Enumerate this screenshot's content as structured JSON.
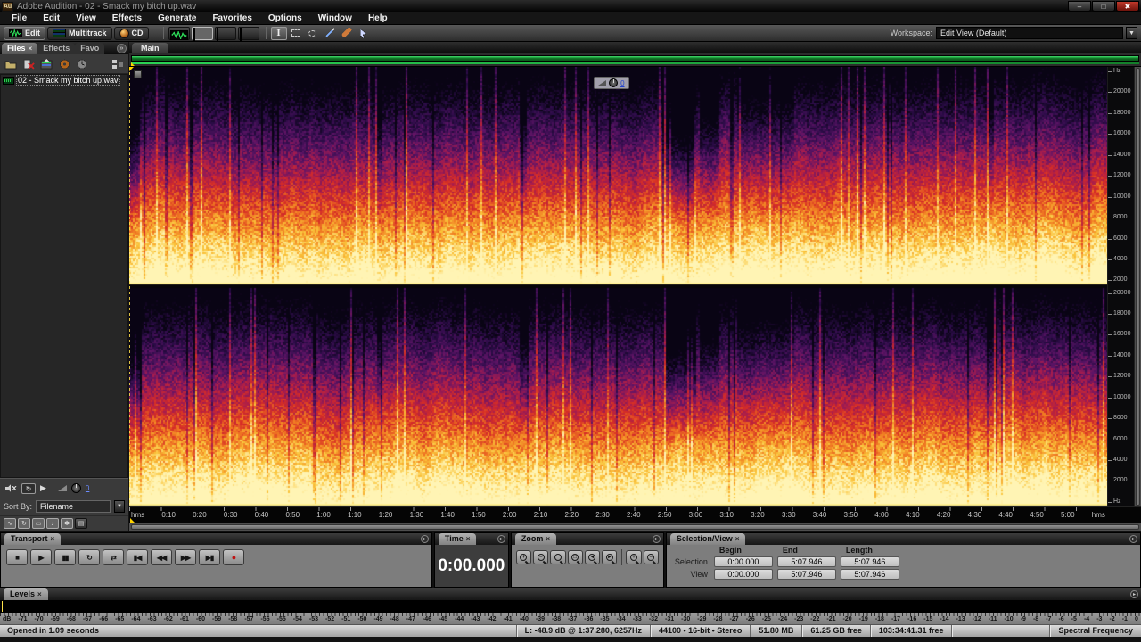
{
  "window": {
    "app_icon": "Au",
    "title": "Adobe Audition - 02 - Smack my bitch up.wav",
    "minimize": "–",
    "restore": "□",
    "close": "✖"
  },
  "menu": {
    "items": [
      "File",
      "Edit",
      "View",
      "Effects",
      "Generate",
      "Favorites",
      "Options",
      "Window",
      "Help"
    ]
  },
  "toolbar": {
    "edit_label": "Edit",
    "multitrack_label": "Multitrack",
    "cd_label": "CD",
    "workspace_label": "Workspace:",
    "workspace_value": "Edit View (Default)",
    "dropdown_arrow": "▼"
  },
  "files_panel": {
    "tab_files": "Files",
    "tab_effects": "Effects",
    "tab_favorites": "Favo",
    "close_glyph": "×",
    "file_name": "02 - Smack my bitch up.wav",
    "play_glyph": "▶",
    "loop_glyph": "↻",
    "volume_value": "0",
    "sort_label": "Sort By:",
    "sort_value": "Filename",
    "filters": [
      {
        "name": "filter-waveform-icon",
        "glyph": "∿",
        "cls": "on"
      },
      {
        "name": "filter-loop-icon",
        "glyph": "↻",
        "cls": "on"
      },
      {
        "name": "filter-video-icon",
        "glyph": "▭",
        "cls": "on"
      },
      {
        "name": "filter-midi-icon",
        "glyph": "♪",
        "cls": "on"
      },
      {
        "name": "filter-marker-icon",
        "glyph": "✱",
        "cls": "on"
      },
      {
        "name": "filter-session-icon",
        "glyph": "▤",
        "cls": ""
      }
    ]
  },
  "main_panel": {
    "tab": "Main",
    "overlay_volume": "0"
  },
  "freq_ruler": {
    "top": [
      "Hz",
      "20000",
      "18000",
      "16000",
      "14000",
      "12000",
      "10000",
      "8000",
      "6000",
      "4000",
      "2000"
    ],
    "bottom": [
      "20000",
      "18000",
      "16000",
      "14000",
      "12000",
      "10000",
      "8000",
      "6000",
      "4000",
      "2000",
      "Hz"
    ]
  },
  "time_ruler": {
    "labels": [
      "hms",
      "0:10",
      "0:20",
      "0:30",
      "0:40",
      "0:50",
      "1:00",
      "1:10",
      "1:20",
      "1:30",
      "1:40",
      "1:50",
      "2:00",
      "2:10",
      "2:20",
      "2:30",
      "2:40",
      "2:50",
      "3:00",
      "3:10",
      "3:20",
      "3:30",
      "3:40",
      "3:50",
      "4:00",
      "4:10",
      "4:20",
      "4:30",
      "4:40",
      "4:50",
      "5:00",
      "hms"
    ]
  },
  "transport": {
    "tab": "Transport",
    "buttons": [
      {
        "name": "stop-button",
        "glyph": "■"
      },
      {
        "name": "play-button",
        "glyph": "▶"
      },
      {
        "name": "pause-button",
        "glyph": "▮▮"
      },
      {
        "name": "play-looped-button",
        "glyph": "↻"
      },
      {
        "name": "loop-button",
        "glyph": "⇄"
      },
      {
        "name": "go-to-beginning-button",
        "glyph": "▮◀"
      },
      {
        "name": "rewind-button",
        "glyph": "◀◀"
      },
      {
        "name": "fast-forward-button",
        "glyph": "▶▶"
      },
      {
        "name": "go-to-end-button",
        "glyph": "▶▮"
      },
      {
        "name": "record-button",
        "glyph": "●",
        "cls": "rec"
      }
    ]
  },
  "time_panel": {
    "tab": "Time",
    "value": "0:00.000"
  },
  "zoom_panel": {
    "tab": "Zoom",
    "buttons": [
      {
        "name": "zoom-in-horizontal-button",
        "sign": "+",
        "cls": ""
      },
      {
        "name": "zoom-out-horizontal-button",
        "sign": "−",
        "cls": ""
      },
      {
        "name": "zoom-out-full-button",
        "sign": "",
        "cls": ""
      },
      {
        "name": "zoom-to-selection-button",
        "sign": "□",
        "cls": ""
      },
      {
        "name": "zoom-in-left-button",
        "sign": "◂",
        "cls": ""
      },
      {
        "name": "zoom-in-right-button",
        "sign": "▸",
        "cls": ""
      },
      {
        "name": "zoom-in-vertical-button",
        "sign": "+",
        "cls": "vgap"
      },
      {
        "name": "zoom-out-vertical-button",
        "sign": "−",
        "cls": ""
      }
    ]
  },
  "selection_panel": {
    "tab": "Selection/View",
    "columns": [
      "Begin",
      "End",
      "Length"
    ],
    "rows": [
      {
        "label": "Selection",
        "values": [
          "0:00.000",
          "5:07.946",
          "5:07.946"
        ]
      },
      {
        "label": "View",
        "values": [
          "0:00.000",
          "5:07.946",
          "5:07.946"
        ]
      }
    ]
  },
  "levels": {
    "tab": "Levels",
    "scale": [
      "dB",
      "-71",
      "-70",
      "-69",
      "-68",
      "-67",
      "-66",
      "-65",
      "-64",
      "-63",
      "-62",
      "-61",
      "-60",
      "-59",
      "-58",
      "-57",
      "-56",
      "-55",
      "-54",
      "-53",
      "-52",
      "-51",
      "-50",
      "-49",
      "-48",
      "-47",
      "-46",
      "-45",
      "-44",
      "-43",
      "-42",
      "-41",
      "-40",
      "-39",
      "-38",
      "-37",
      "-36",
      "-35",
      "-34",
      "-33",
      "-32",
      "-31",
      "-30",
      "-29",
      "-28",
      "-27",
      "-26",
      "-25",
      "-24",
      "-23",
      "-22",
      "-21",
      "-20",
      "-19",
      "-18",
      "-17",
      "-16",
      "-15",
      "-14",
      "-13",
      "-12",
      "-11",
      "-10",
      "-9",
      "-8",
      "-7",
      "-6",
      "-5",
      "-4",
      "-3",
      "-2",
      "-1",
      "0"
    ]
  },
  "status_bar": {
    "left": "Opened in 1.09 seconds",
    "segments": [
      "L: -48.9 dB @  1:37.280, 6257Hz",
      "44100 • 16-bit • Stereo",
      "51.80 MB",
      "61.25 GB free",
      "103:34:41.31 free",
      "",
      "Spectral Frequency"
    ]
  },
  "colors": {
    "accent_green": "#2bd455",
    "playhead_yellow": "#ffd400",
    "record_red": "#c01212",
    "spectro_low": "#140616",
    "spectro_mid": "#d62d26",
    "spectro_high": "#fff4b4"
  }
}
